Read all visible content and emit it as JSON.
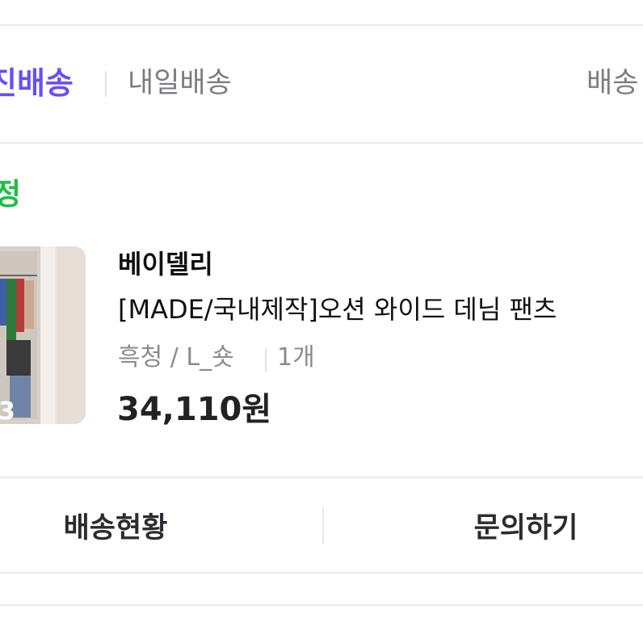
{
  "tabs": {
    "active": "진배송",
    "next": "내일배송",
    "right": "배송"
  },
  "order": {
    "status": "정",
    "seller": "베이델리",
    "product_name": "[MADE/국내제작]오션 와이드 데님 팬츠",
    "option": "흑청 / L_숏",
    "quantity": "1개",
    "price": "34,110원",
    "thumbnail_corner_text": "3"
  },
  "actions": {
    "shipping_status": "배송현황",
    "inquiry": "문의하기"
  },
  "colors": {
    "accent": "#6b4ff2",
    "status": "#1fbf47",
    "muted": "#8a8a91",
    "divider": "#ececef"
  }
}
